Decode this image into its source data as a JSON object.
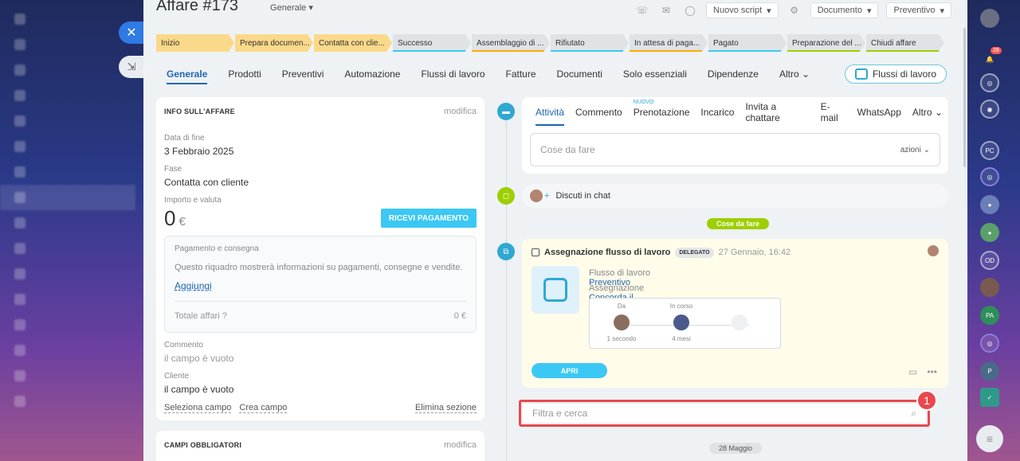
{
  "header": {
    "title": "Affare #173",
    "category": "Generale",
    "script_btn": "Nuovo script",
    "documents_btn": "Documento",
    "estimate_btn": "Preventivo"
  },
  "stages": [
    {
      "label": "Inizio",
      "state": "done",
      "color": "#fbd98a"
    },
    {
      "label": "Prepara documen...",
      "state": "done",
      "color": "#fbd98a"
    },
    {
      "label": "Contatta con clie...",
      "state": "done",
      "color": "#fbd98a"
    },
    {
      "label": "Successo",
      "state": "todo",
      "color": "#3bc8f5"
    },
    {
      "label": "Assemblaggio di ...",
      "state": "todo",
      "color": "#ffa900"
    },
    {
      "label": "Rifiutato",
      "state": "todo",
      "color": "#3bc8f5"
    },
    {
      "label": "In attesa di paga...",
      "state": "todo",
      "color": "#ffa900"
    },
    {
      "label": "Pagato",
      "state": "todo",
      "color": "#3bc8f5"
    },
    {
      "label": "Preparazione del ...",
      "state": "todo",
      "color": "#9dcf00"
    },
    {
      "label": "Chiudi affare",
      "state": "todo",
      "color": "#9dcf00"
    }
  ],
  "tabs": [
    "Generale",
    "Prodotti",
    "Preventivi",
    "Automazione",
    "Flussi di lavoro",
    "Fatture",
    "Documenti",
    "Solo essenziali",
    "Dipendenze",
    "Altro"
  ],
  "workflow_button": "Flussi di lavoro",
  "info": {
    "heading": "INFO SULL'AFFARE",
    "edit": "modifica",
    "end_date_label": "Data di fine",
    "end_date": "3 Febbraio 2025",
    "stage_label": "Fase",
    "stage": "Contatta con cliente",
    "amount_label": "Importo e valuta",
    "amount": "0",
    "currency": "€",
    "pay_button": "RICEVI PAGAMENTO",
    "pay_title": "Pagamento e consegna",
    "pay_desc": "Questo riquadro mostrerà informazioni su pagamenti, consegne e vendite.",
    "pay_add": "Aggiungi",
    "total_label": "Totale affari",
    "total_value": "0 €",
    "comment_label": "Commento",
    "comment_value": "il campo è vuoto",
    "client_label": "Cliente",
    "client_value": "il campo è vuoto",
    "select_field": "Seleziona campo",
    "create_field": "Crea campo",
    "delete_section": "Elimina sezione"
  },
  "required": {
    "heading": "CAMPI OBBLIGATORI",
    "edit": "modifica"
  },
  "activity": {
    "tabs": [
      "Attività",
      "Commento",
      "Prenotazione",
      "Incarico",
      "Invita a chattare",
      "E-mail",
      "WhatsApp",
      "Altro"
    ],
    "new_badge": "NUOVO",
    "todo_placeholder": "Cose da fare",
    "actions": "azioni"
  },
  "chat": {
    "label": "Discuti in chat"
  },
  "separator_todo": "Cose da fare",
  "task": {
    "title": "Assegnazione flusso di lavoro",
    "badge": "DELEGATO",
    "date": "27 Gennaio, 16:42",
    "flow_label": "Flusso di lavoro",
    "flow_value": "Preventivo",
    "assign_label": "Assegnazione",
    "assign_value": "Concorda il preventivo",
    "from_label": "Da",
    "from_time": "1 secondo",
    "progress_label": "In corso",
    "progress_time": "4 mesi",
    "open_button": "APRI"
  },
  "filter": {
    "placeholder": "Filtra e cerca"
  },
  "callout_number": "1",
  "separator_date": "28 Maggio",
  "notifications": "28",
  "right_bar": [
    "PC",
    "OD",
    "PA",
    "P"
  ]
}
